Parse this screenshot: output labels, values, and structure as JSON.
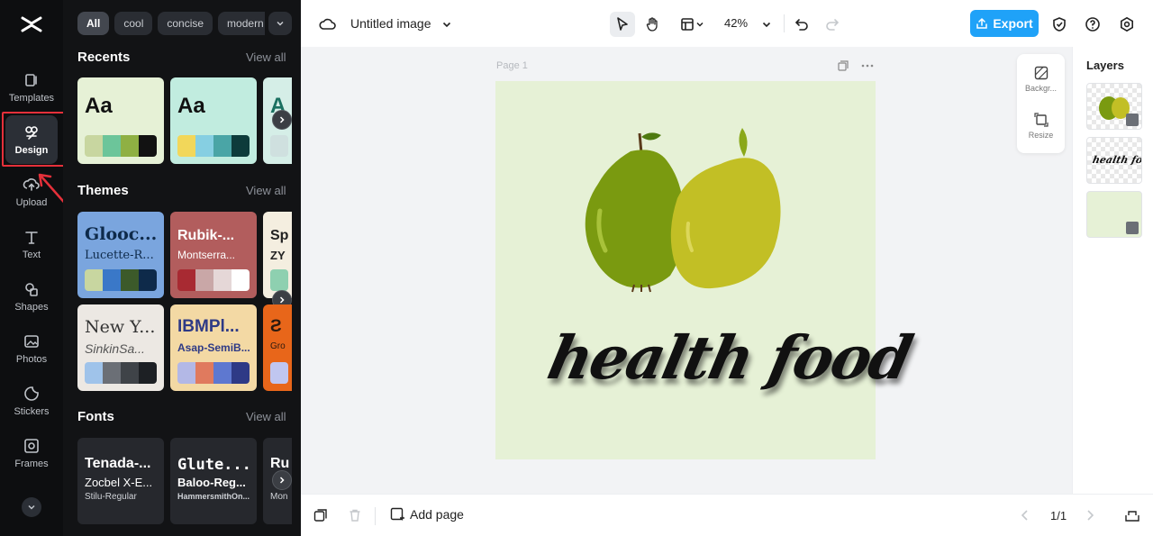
{
  "rail": {
    "items": [
      {
        "label": "Templates",
        "icon": "templates-icon"
      },
      {
        "label": "Design",
        "icon": "design-icon"
      },
      {
        "label": "Upload",
        "icon": "upload-icon"
      },
      {
        "label": "Text",
        "icon": "text-icon"
      },
      {
        "label": "Shapes",
        "icon": "shapes-icon"
      },
      {
        "label": "Photos",
        "icon": "photos-icon"
      },
      {
        "label": "Stickers",
        "icon": "stickers-icon"
      },
      {
        "label": "Frames",
        "icon": "frames-icon"
      }
    ]
  },
  "panel": {
    "chips": [
      "All",
      "cool",
      "concise",
      "modern"
    ],
    "recents": {
      "title": "Recents",
      "view_all": "View all",
      "cards": [
        {
          "sample": "Aa",
          "bg": "#e6f1d6",
          "swatches": [
            "#c8d6a0",
            "#6cc59a",
            "#8fb043",
            "#121212"
          ]
        },
        {
          "sample": "Aa",
          "bg": "#c1ecdf",
          "swatches": [
            "#f2d75a",
            "#86cfe2",
            "#4aa5a6",
            "#0d3b3b"
          ]
        },
        {
          "sample": "A",
          "bg": "#d5eee7",
          "swatches": [
            "#cfe0df"
          ]
        }
      ]
    },
    "themes": {
      "title": "Themes",
      "view_all": "View all",
      "cards": [
        {
          "title": "Glooc...",
          "sub": "Lucette-R...",
          "bg": "#7aa5de",
          "fg": "#0e2a4a",
          "swatches": [
            "#c8d6a0",
            "#3a78c8",
            "#3c5a2a",
            "#0e2a4a"
          ]
        },
        {
          "title": "Rubik-...",
          "sub": "Montserra...",
          "bg": "#b25d5d",
          "fg": "#ffffff",
          "swatches": [
            "#a82a32",
            "#c9a7a7",
            "#e5d7d7",
            "#ffffff"
          ]
        },
        {
          "title": "Sp",
          "sub": "ZY",
          "bg": "#f4eee0",
          "fg": "#222222",
          "swatches": [
            "#8ed0b0"
          ]
        },
        {
          "title": "New Y...",
          "sub": "SinkinSa...",
          "bg": "#ece8e3",
          "fg": "#333333",
          "swatches": [
            "#9fc3ea",
            "#6b6f76",
            "#3f4348",
            "#1d2024"
          ]
        },
        {
          "title": "IBMPl...",
          "sub": "Asap-SemiB...",
          "bg": "#f3d9a4",
          "fg": "#2e3a86",
          "swatches": [
            "#b3b8e6",
            "#e07a5e",
            "#5e78d0",
            "#2e3a86"
          ]
        },
        {
          "title": "Ƨ",
          "sub": "Gro",
          "bg": "#e8661a",
          "fg": "#2a1a10",
          "swatches": [
            "#c0c6f0"
          ]
        }
      ]
    },
    "fonts": {
      "title": "Fonts",
      "view_all": "View all",
      "cards": [
        {
          "l1": "Tenada-...",
          "l2": "Zocbel X-E...",
          "l3": "Stilu-Regular"
        },
        {
          "l1": "Glute...",
          "l2": "Baloo-Reg...",
          "l3": "HammersmithOn..."
        },
        {
          "l1": "Ru",
          "l2": "",
          "l3": "Mon"
        }
      ]
    }
  },
  "topbar": {
    "doc_title": "Untitled image",
    "zoom": "42%",
    "export_label": "Export"
  },
  "canvas": {
    "page_label": "Page 1",
    "design_text": "health food",
    "float_tools": [
      {
        "label": "Backgr...",
        "icon": "background-icon"
      },
      {
        "label": "Resize",
        "icon": "resize-icon"
      }
    ]
  },
  "layers": {
    "title": "Layers"
  },
  "bottombar": {
    "add_page": "Add page",
    "pager": "1/1"
  },
  "colors": {
    "accent": "#1fa2f8",
    "highlight": "#e5303a",
    "page_bg": "#e6f1d6",
    "pear": "#7a9a10",
    "lemon": "#c2bf25"
  }
}
